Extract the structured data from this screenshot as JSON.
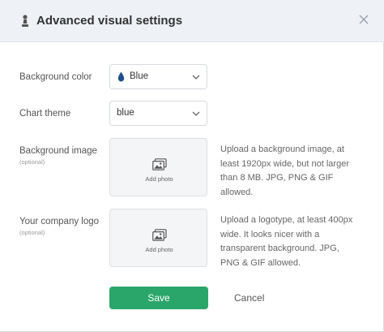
{
  "dialog": {
    "title": "Advanced visual settings",
    "title_icon": "pawn-icon",
    "close_icon": "close-icon"
  },
  "background_color": {
    "label": "Background color",
    "value": "Blue",
    "icon": "water-drop-icon",
    "icon_color": "#1e4f8c"
  },
  "chart_theme": {
    "label": "Chart theme",
    "value": "blue"
  },
  "background_image": {
    "label": "Background image",
    "sublabel": "(optional)",
    "upload_label": "Add photo",
    "help": "Upload a background image, at least 1920px wide, but not larger than 8 MB. JPG, PNG & GIF allowed."
  },
  "company_logo": {
    "label": "Your company logo",
    "sublabel": "(optional)",
    "upload_label": "Add photo",
    "help": "Upload a logotype, at least 400px wide. It looks nicer with a transparent background. JPG, PNG & GIF allowed."
  },
  "actions": {
    "save": "Save",
    "cancel": "Cancel",
    "save_color": "#2ba66a"
  }
}
